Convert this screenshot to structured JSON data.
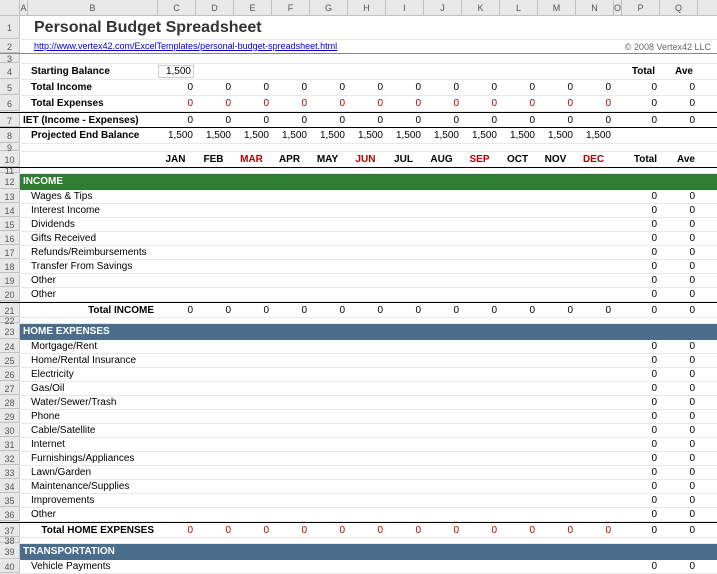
{
  "title": "Personal Budget Spreadsheet",
  "link": "http://www.vertex42.com/ExcelTemplates/personal-budget-spreadsheet.html",
  "copyright": "© 2008 Vertex42 LLC",
  "cols": [
    "A",
    "B",
    "C",
    "D",
    "E",
    "F",
    "G",
    "H",
    "I",
    "J",
    "K",
    "L",
    "M",
    "N",
    "O",
    "P",
    "Q"
  ],
  "labels": {
    "starting_balance": "Starting Balance",
    "total_income": "Total Income",
    "total_expenses": "Total Expenses",
    "net": "IET (Income - Expenses)",
    "projected_end": "Projected End Balance",
    "total": "Total",
    "ave": "Ave"
  },
  "starting_balance": "1,500",
  "months": [
    "JAN",
    "FEB",
    "MAR",
    "APR",
    "MAY",
    "JUN",
    "JUL",
    "AUG",
    "SEP",
    "OCT",
    "NOV",
    "DEC"
  ],
  "month_red": [
    false,
    false,
    true,
    false,
    false,
    true,
    false,
    false,
    true,
    false,
    false,
    true
  ],
  "zero_row": [
    "0",
    "0",
    "0",
    "0",
    "0",
    "0",
    "0",
    "0",
    "0",
    "0",
    "0",
    "0"
  ],
  "proj_row": [
    "1,500",
    "1,500",
    "1,500",
    "1,500",
    "1,500",
    "1,500",
    "1,500",
    "1,500",
    "1,500",
    "1,500",
    "1,500",
    "1,500"
  ],
  "sections": {
    "income": {
      "title": "INCOME",
      "items": [
        "Wages & Tips",
        "Interest Income",
        "Dividends",
        "Gifts Received",
        "Refunds/Reimbursements",
        "Transfer From Savings",
        "Other",
        "Other"
      ],
      "total_label": "Total INCOME"
    },
    "home": {
      "title": "HOME EXPENSES",
      "items": [
        "Mortgage/Rent",
        "Home/Rental Insurance",
        "Electricity",
        "Gas/Oil",
        "Water/Sewer/Trash",
        "Phone",
        "Cable/Satellite",
        "Internet",
        "Furnishings/Appliances",
        "Lawn/Garden",
        "Maintenance/Supplies",
        "Improvements",
        "Other"
      ],
      "total_label": "Total HOME EXPENSES"
    },
    "transport": {
      "title": "TRANSPORTATION",
      "items": [
        "Vehicle Payments"
      ]
    }
  }
}
